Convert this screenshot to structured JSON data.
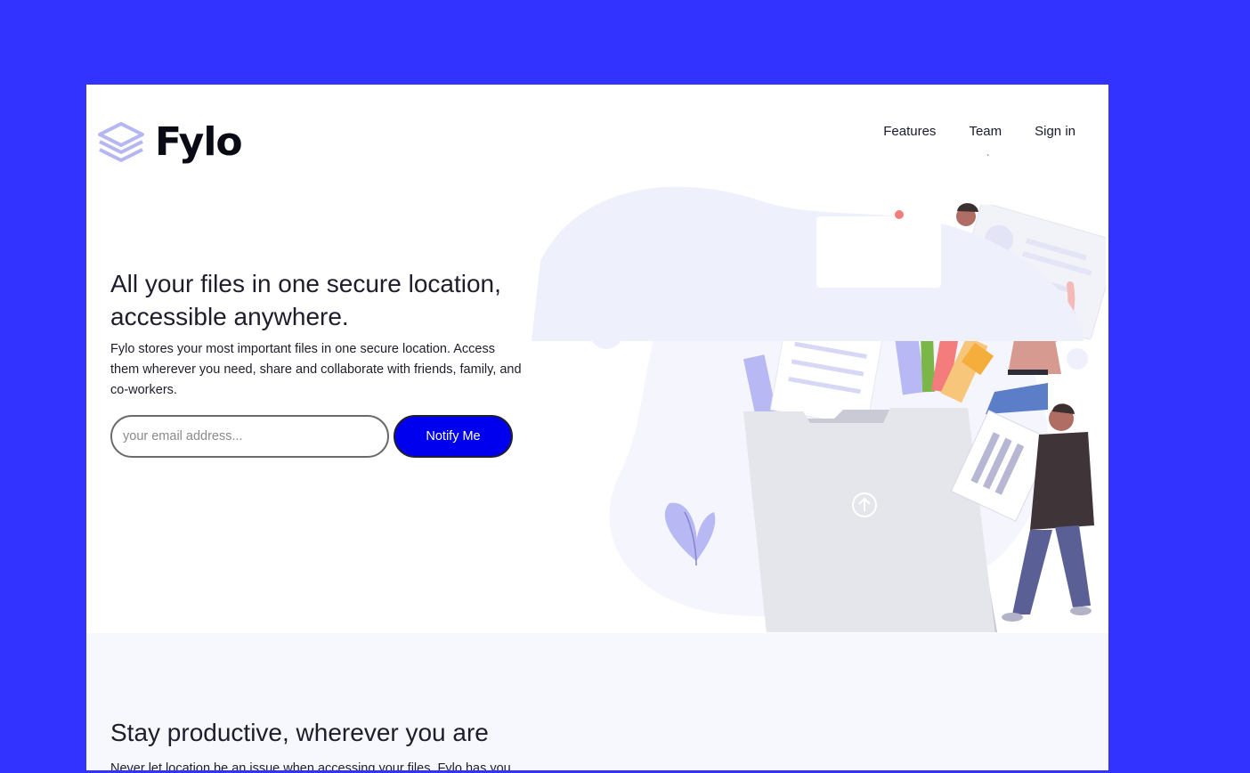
{
  "brand": {
    "name": "Fylo"
  },
  "nav": {
    "items": [
      "Features",
      "Team",
      "Sign in"
    ],
    "marker": "`"
  },
  "hero": {
    "title": "All your files in one secure location, accessible anywhere.",
    "text": "Fylo stores your most important files in one secure location. Access them wherever you need, share and collaborate with friends, family, and co-workers.",
    "email_placeholder": "your email address...",
    "button_label": "Notify Me"
  },
  "productive": {
    "title": "Stay productive, wherever you are",
    "text": "Never let location be an issue when accessing your files. Fylo has you"
  },
  "colors": {
    "background": "#3333ff",
    "button": "#0000ee",
    "logo": "#b6b6f2",
    "section_bg": "#f7f8fd"
  },
  "icons": {
    "logo": "stacked-layers-icon",
    "upload": "upload-arrow-icon"
  }
}
